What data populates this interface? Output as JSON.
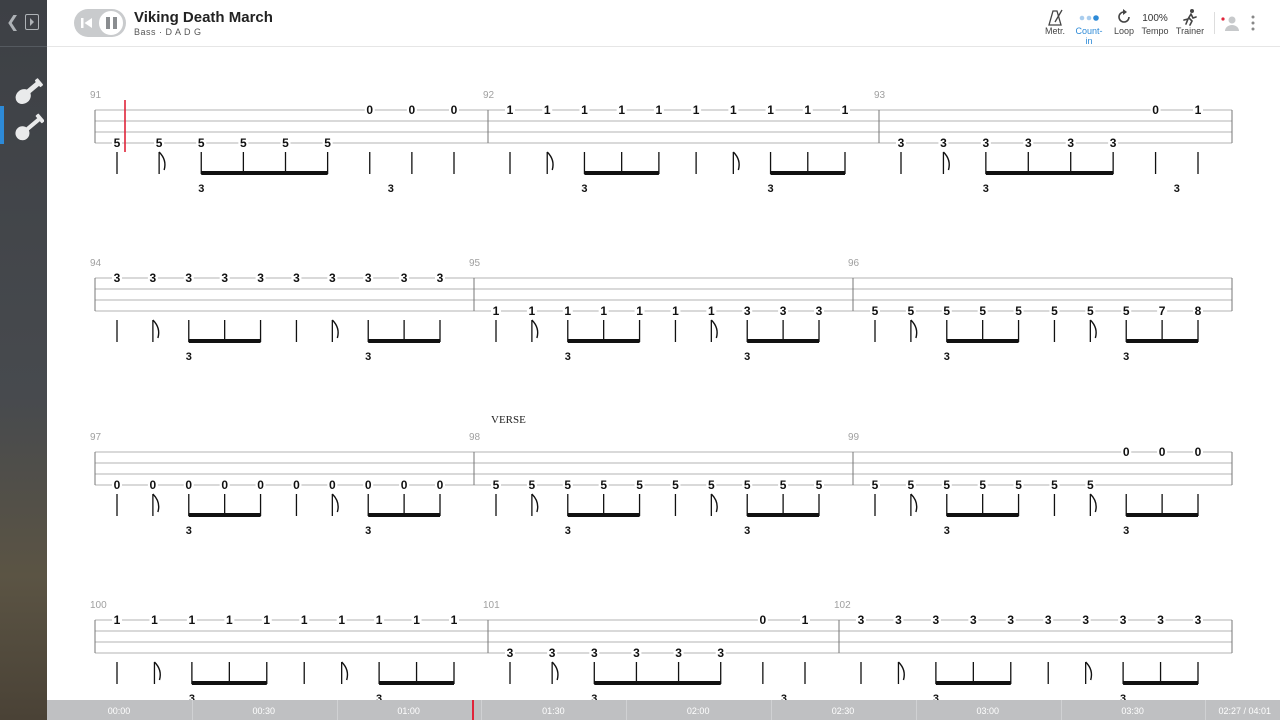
{
  "song": {
    "title": "Viking Death March",
    "subtitle": "Bass · D A D G"
  },
  "toolbar": {
    "metronome": "Metr.",
    "count_in": "Count-in",
    "loop": "Loop",
    "tempo_value": "100%",
    "tempo": "Tempo",
    "trainer": "Trainer"
  },
  "colors": {
    "accent": "#2d8ad7",
    "cursor": "#e0243a",
    "staff": "#9a9a9a"
  },
  "score": {
    "section_marker": "VERSE",
    "rows": [
      {
        "measures": [
          {
            "number": "91",
            "notes": [
              [
                "5",
                3
              ],
              [
                "5",
                3
              ],
              [
                "5",
                3
              ],
              [
                "5",
                3
              ],
              [
                "5",
                3
              ],
              [
                "5",
                3
              ],
              [
                "0",
                0
              ],
              [
                "0",
                0
              ],
              [
                "0",
                0
              ]
            ]
          },
          {
            "number": "92",
            "notes": [
              [
                "1",
                0
              ],
              [
                "1",
                0
              ],
              [
                "1",
                0
              ],
              [
                "1",
                0
              ],
              [
                "1",
                0
              ],
              [
                "1",
                0
              ],
              [
                "1",
                0
              ],
              [
                "1",
                0
              ],
              [
                "1",
                0
              ],
              [
                "1",
                0
              ]
            ]
          },
          {
            "number": "93",
            "notes": [
              [
                "3",
                3
              ],
              [
                "3",
                3
              ],
              [
                "3",
                3
              ],
              [
                "3",
                3
              ],
              [
                "3",
                3
              ],
              [
                "3",
                3
              ],
              [
                "0",
                0
              ],
              [
                "1",
                0
              ]
            ]
          }
        ]
      },
      {
        "measures": [
          {
            "number": "94",
            "notes": [
              [
                "3",
                0
              ],
              [
                "3",
                0
              ],
              [
                "3",
                0
              ],
              [
                "3",
                0
              ],
              [
                "3",
                0
              ],
              [
                "3",
                0
              ],
              [
                "3",
                0
              ],
              [
                "3",
                0
              ],
              [
                "3",
                0
              ],
              [
                "3",
                0
              ]
            ]
          },
          {
            "number": "95",
            "notes": [
              [
                "1",
                3
              ],
              [
                "1",
                3
              ],
              [
                "1",
                3
              ],
              [
                "1",
                3
              ],
              [
                "1",
                3
              ],
              [
                "1",
                3
              ],
              [
                "1",
                3
              ],
              [
                "3",
                3
              ],
              [
                "3",
                3
              ],
              [
                "3",
                3
              ]
            ]
          },
          {
            "number": "96",
            "notes": [
              [
                "5",
                3
              ],
              [
                "5",
                3
              ],
              [
                "5",
                3
              ],
              [
                "5",
                3
              ],
              [
                "5",
                3
              ],
              [
                "5",
                3
              ],
              [
                "5",
                3
              ],
              [
                "5",
                3
              ],
              [
                "7",
                3
              ],
              [
                "8",
                3
              ]
            ]
          }
        ]
      },
      {
        "measures": [
          {
            "number": "97",
            "notes": [
              [
                "0",
                3
              ],
              [
                "0",
                3
              ],
              [
                "0",
                3
              ],
              [
                "0",
                3
              ],
              [
                "0",
                3
              ],
              [
                "0",
                3
              ],
              [
                "0",
                3
              ],
              [
                "0",
                3
              ],
              [
                "0",
                3
              ],
              [
                "0",
                3
              ]
            ]
          },
          {
            "number": "98",
            "notes": [
              [
                "5",
                3
              ],
              [
                "5",
                3
              ],
              [
                "5",
                3
              ],
              [
                "5",
                3
              ],
              [
                "5",
                3
              ],
              [
                "5",
                3
              ],
              [
                "5",
                3
              ],
              [
                "5",
                3
              ],
              [
                "5",
                3
              ],
              [
                "5",
                3
              ]
            ]
          },
          {
            "number": "99",
            "notes": [
              [
                "5",
                3
              ],
              [
                "5",
                3
              ],
              [
                "5",
                3
              ],
              [
                "5",
                3
              ],
              [
                "5",
                3
              ],
              [
                "5",
                3
              ],
              [
                "5",
                3
              ],
              [
                "0",
                0
              ],
              [
                "0",
                0
              ],
              [
                "0",
                0
              ]
            ]
          }
        ]
      },
      {
        "measures": [
          {
            "number": "100",
            "notes": [
              [
                "1",
                0
              ],
              [
                "1",
                0
              ],
              [
                "1",
                0
              ],
              [
                "1",
                0
              ],
              [
                "1",
                0
              ],
              [
                "1",
                0
              ],
              [
                "1",
                0
              ],
              [
                "1",
                0
              ],
              [
                "1",
                0
              ],
              [
                "1",
                0
              ]
            ]
          },
          {
            "number": "101",
            "notes": [
              [
                "3",
                3
              ],
              [
                "3",
                3
              ],
              [
                "3",
                3
              ],
              [
                "3",
                3
              ],
              [
                "3",
                3
              ],
              [
                "3",
                3
              ],
              [
                "0",
                0
              ],
              [
                "1",
                0
              ]
            ]
          },
          {
            "number": "102",
            "notes": [
              [
                "3",
                0
              ],
              [
                "3",
                0
              ],
              [
                "3",
                0
              ],
              [
                "3",
                0
              ],
              [
                "3",
                0
              ],
              [
                "3",
                0
              ],
              [
                "3",
                0
              ],
              [
                "3",
                0
              ],
              [
                "3",
                0
              ],
              [
                "3",
                0
              ]
            ]
          }
        ]
      }
    ],
    "triplet_label": "3"
  },
  "timeline": {
    "ticks": [
      "00:00",
      "00:30",
      "01:00",
      "01:30",
      "02:00",
      "02:30",
      "03:00",
      "03:30"
    ],
    "position": "02:27 / 04:01",
    "progress": 0.61
  }
}
